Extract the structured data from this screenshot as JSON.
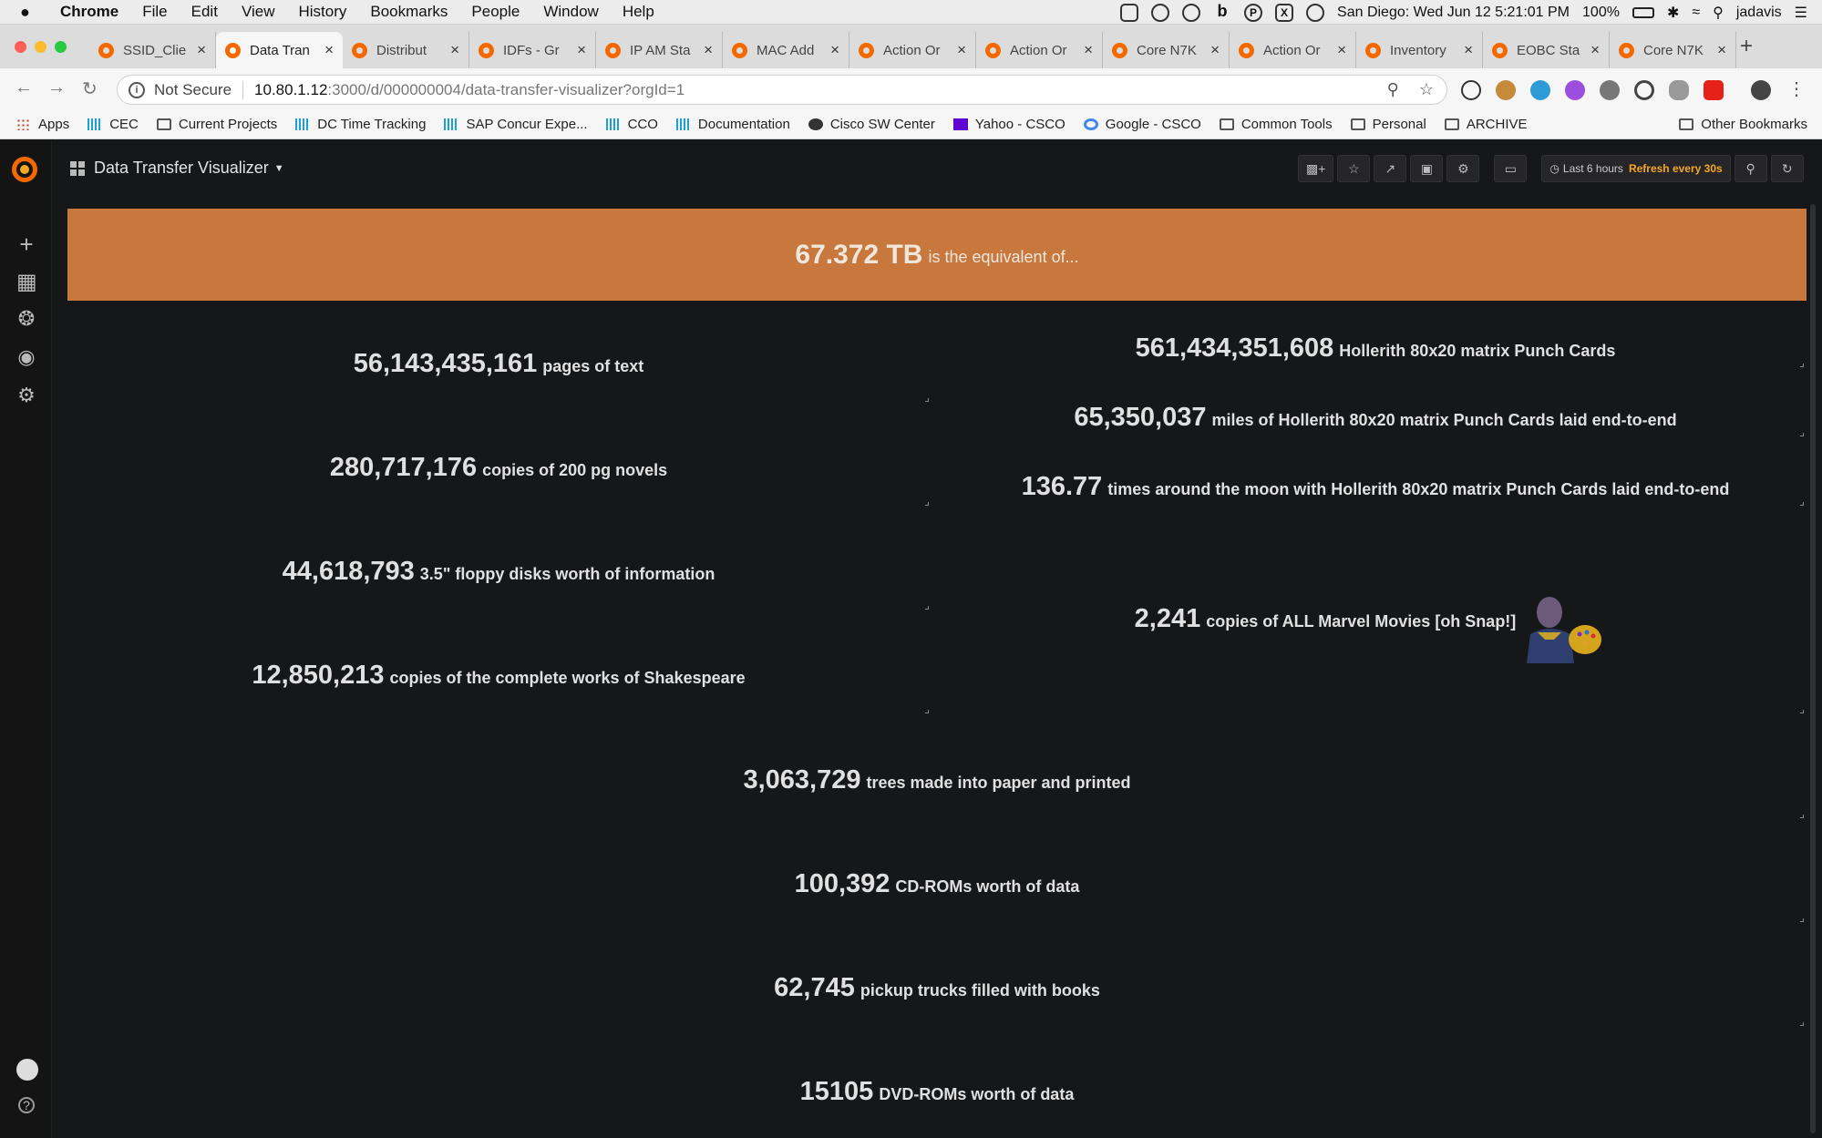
{
  "menubar": {
    "apple": "",
    "items": [
      "Chrome",
      "File",
      "Edit",
      "View",
      "History",
      "Bookmarks",
      "People",
      "Window",
      "Help"
    ],
    "status_icons": [
      "b",
      "P",
      "X"
    ],
    "clock": "San Diego: Wed Jun 12  5:21:01 PM",
    "battery": "100%",
    "user": "jadavis"
  },
  "tabs": [
    {
      "label": "SSID_Clie"
    },
    {
      "label": "Data Tran"
    },
    {
      "label": "Distribut"
    },
    {
      "label": "IDFs - Gr"
    },
    {
      "label": "IP AM Sta"
    },
    {
      "label": "MAC Add"
    },
    {
      "label": "Action Or"
    },
    {
      "label": "Action Or"
    },
    {
      "label": "Core N7K"
    },
    {
      "label": "Action Or"
    },
    {
      "label": "Inventory"
    },
    {
      "label": "EOBC Sta"
    },
    {
      "label": "Core N7K"
    }
  ],
  "address": {
    "security": "Not Secure",
    "host": "10.80.1.12",
    "path": ":3000/d/000000004/data-transfer-visualizer?orgId=1"
  },
  "bookmarks": [
    {
      "label": "Apps",
      "icon": "grid"
    },
    {
      "label": "CEC",
      "icon": "cisco"
    },
    {
      "label": "Current Projects",
      "icon": "folder"
    },
    {
      "label": "DC Time Tracking",
      "icon": "cisco"
    },
    {
      "label": "SAP Concur Expe...",
      "icon": "cisco"
    },
    {
      "label": "CCO",
      "icon": "cisco"
    },
    {
      "label": "Documentation",
      "icon": "cisco"
    },
    {
      "label": "Cisco SW Center",
      "icon": "round"
    },
    {
      "label": "Yahoo - CSCO",
      "icon": "yahoo"
    },
    {
      "label": "Google - CSCO",
      "icon": "google"
    },
    {
      "label": "Common Tools",
      "icon": "folder"
    },
    {
      "label": "Personal",
      "icon": "folder"
    },
    {
      "label": "ARCHIVE",
      "icon": "folder"
    }
  ],
  "other_bookmarks": "Other Bookmarks",
  "dashboard": {
    "title": "Data Transfer Visualizer",
    "time_range": "Last 6 hours",
    "refresh": "Refresh every 30s",
    "headline_value": "67.372 TB",
    "headline_text": "is the equivalent of..."
  },
  "stats_left": [
    {
      "value": "56,143,435,161",
      "unit": "pages of text"
    },
    {
      "value": "280,717,176",
      "unit": "copies of 200 pg novels"
    },
    {
      "value": "44,618,793",
      "unit": "3.5\" floppy disks worth of information"
    },
    {
      "value": "12,850,213",
      "unit": "copies of the complete works of Shakespeare"
    }
  ],
  "stats_right": [
    {
      "value": "561,434,351,608",
      "unit": "Hollerith 80x20 matrix Punch Cards"
    },
    {
      "value": "65,350,037",
      "unit": "miles of Hollerith 80x20 matrix Punch Cards laid end-to-end"
    },
    {
      "value": "136.77",
      "unit": "times around the moon with Hollerith 80x20 matrix Punch Cards laid end-to-end"
    },
    {
      "value": "2,241",
      "unit": "copies of ALL Marvel Movies [oh Snap!]"
    }
  ],
  "stats_center": [
    {
      "value": "3,063,729",
      "unit": "trees made into paper and printed"
    },
    {
      "value": "100,392",
      "unit": "CD-ROMs worth of data"
    },
    {
      "value": "62,745",
      "unit": "pickup trucks filled with books"
    },
    {
      "value": "15105",
      "unit": "DVD-ROMs worth of data"
    }
  ],
  "colors": {
    "banner": "#c8773d",
    "grafana_orange": "#f46800",
    "refresh_text": "#f5a623",
    "background": "#161719"
  }
}
